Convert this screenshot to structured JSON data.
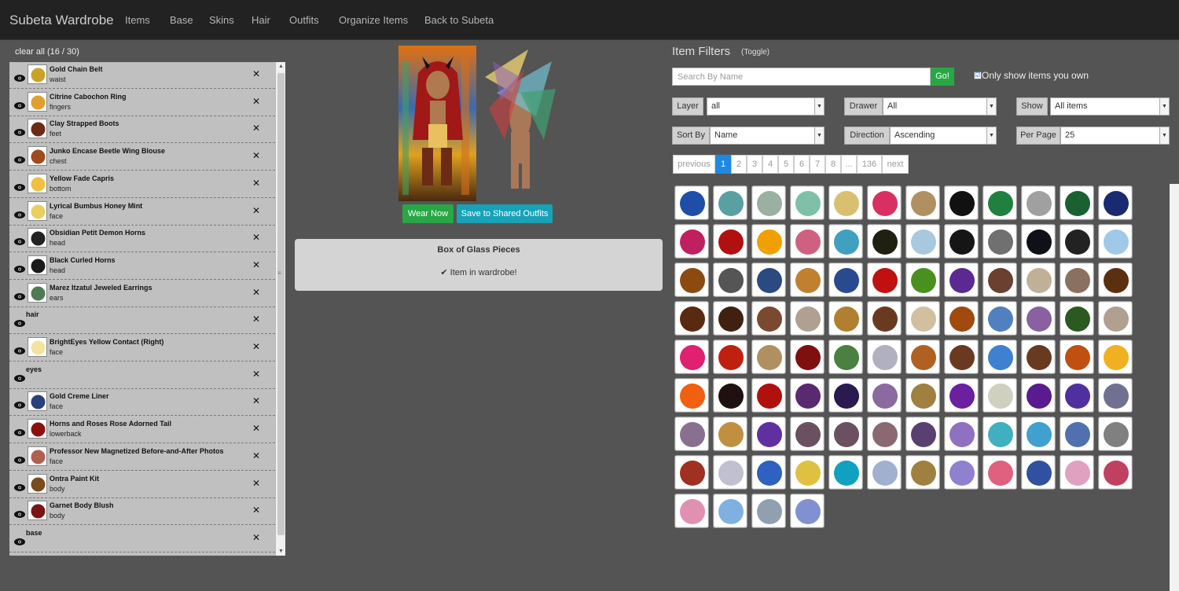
{
  "navbar": {
    "brand": "Subeta Wardrobe",
    "links": [
      "Items",
      "Base",
      "Skins",
      "Hair",
      "Outfits",
      "Organize Items",
      "Back to Subeta"
    ]
  },
  "layers": {
    "clear_all": "clear all (16 / 30)",
    "rows": [
      {
        "name": "Gold Chain Belt",
        "slot": "waist",
        "color": "#c9a227"
      },
      {
        "name": "Citrine Cabochon Ring",
        "slot": "fingers",
        "color": "#e0a030"
      },
      {
        "name": "Clay Strapped Boots",
        "slot": "feet",
        "color": "#6b2b14"
      },
      {
        "name": "Junko Encase Beetle Wing Blouse",
        "slot": "chest",
        "color": "#a04a20"
      },
      {
        "name": "Yellow Fade Capris",
        "slot": "bottom",
        "color": "#f0c040"
      },
      {
        "name": "Lyrical Bumbus Honey Mint",
        "slot": "face",
        "color": "#e8d060"
      },
      {
        "name": "Obsidian Petit Demon Horns",
        "slot": "head",
        "color": "#222222"
      },
      {
        "name": "Black Curled Horns",
        "slot": "head",
        "color": "#1a1a1a"
      },
      {
        "name": "Marez Itzatul Jeweled Earrings",
        "slot": "ears",
        "color": "#4f7a54"
      },
      {
        "name": "hair",
        "slot": "",
        "color": ""
      },
      {
        "name": "BrightEyes Yellow Contact (Right)",
        "slot": "face",
        "color": "#f4e2a0"
      },
      {
        "name": "eyes",
        "slot": "",
        "color": ""
      },
      {
        "name": "Gold Creme Liner",
        "slot": "face",
        "color": "#2b3f7a"
      },
      {
        "name": "Horns and Roses Rose Adorned Tail",
        "slot": "lowerback",
        "color": "#8a1010"
      },
      {
        "name": "Professor New Magnetized Before-and-After Photos",
        "slot": "face",
        "color": "#b06050"
      },
      {
        "name": "Ontra Paint Kit",
        "slot": "body",
        "color": "#7a4a20"
      },
      {
        "name": "Garnet Body Blush",
        "slot": "body",
        "color": "#7a1515"
      },
      {
        "name": "base",
        "slot": "",
        "color": ""
      }
    ]
  },
  "preview": {
    "wear_now": "Wear Now",
    "save_shared": "Save to Shared Outfits",
    "item_title": "Box of Glass Pieces",
    "item_status": "✔ Item in wardrobe!"
  },
  "filters": {
    "title": "Item Filters",
    "toggle": "(Toggle)",
    "search_placeholder": "Search By Name",
    "go": "Go!",
    "own_checkbox": "☑",
    "own_label": "Only show items you own",
    "fields": [
      {
        "label": "Layer",
        "value": "all"
      },
      {
        "label": "Drawer",
        "value": "All"
      },
      {
        "label": "Show",
        "value": "All items"
      },
      {
        "label": "Sort By",
        "value": "Name"
      },
      {
        "label": "Direction",
        "value": "Ascending"
      },
      {
        "label": "Per Page",
        "value": "25"
      }
    ]
  },
  "pagination": [
    "previous",
    "1",
    "2",
    "3",
    "4",
    "5",
    "6",
    "7",
    "8",
    "...",
    "136",
    "next"
  ],
  "items": [
    {
      "icon": "blue-balloon-icon",
      "color": "#1f4ea8"
    },
    {
      "icon": "goggles-icon",
      "color": "#5aa0a0"
    },
    {
      "icon": "sword-icon",
      "color": "#9ab0a0"
    },
    {
      "icon": "winged-hat-icon",
      "color": "#7fc0a8"
    },
    {
      "icon": "wreath-icon",
      "color": "#d8c070"
    },
    {
      "icon": "2009-sign-icon",
      "color": "#d83060"
    },
    {
      "icon": "beads-icon",
      "color": "#b09060"
    },
    {
      "icon": "2013-sign-icon",
      "color": "#111111"
    },
    {
      "icon": "party-hat-icon",
      "color": "#208040"
    },
    {
      "icon": "silver-hat-icon",
      "color": "#a0a0a0"
    },
    {
      "icon": "2013-green-sign-icon",
      "color": "#1a6030"
    },
    {
      "icon": "2013-blue-sign-icon",
      "color": "#1a2a70"
    },
    {
      "icon": "2013-pink-sign-icon",
      "color": "#c02060"
    },
    {
      "icon": "2013-red-sign-icon",
      "color": "#b01010"
    },
    {
      "icon": "orange-balloon-icon",
      "color": "#f0a000"
    },
    {
      "icon": "2014-sign-icon",
      "color": "#d06080"
    },
    {
      "icon": "2014-swirl-icon",
      "color": "#40a0c0"
    },
    {
      "icon": "black-book-icon",
      "color": "#202010"
    },
    {
      "icon": "ice-block-icon",
      "color": "#a8c8e0"
    },
    {
      "icon": "black-bag-icon",
      "color": "#151515"
    },
    {
      "icon": "grey-shorts-icon",
      "color": "#707070"
    },
    {
      "icon": "black-hood-icon",
      "color": "#101018"
    },
    {
      "icon": "accordion-icon",
      "color": "#222222"
    },
    {
      "icon": "ice-cube-icon",
      "color": "#a0c8e8"
    },
    {
      "icon": "acorn-icon",
      "color": "#8a4a10"
    },
    {
      "icon": "spider-icon",
      "color": "#555555"
    },
    {
      "icon": "jeans-icon",
      "color": "#2a4a80"
    },
    {
      "icon": "lipstick-icon",
      "color": "#c08030"
    },
    {
      "icon": "swimsuit-icon",
      "color": "#2a4a90"
    },
    {
      "icon": "ladybug-icon",
      "color": "#c01010"
    },
    {
      "icon": "leaf-wreath-icon",
      "color": "#4a9020"
    },
    {
      "icon": "purple-dragon-icon",
      "color": "#5a2a90"
    },
    {
      "icon": "gargoyle-icon",
      "color": "#6a4030"
    },
    {
      "icon": "mask-icon",
      "color": "#c0b098"
    },
    {
      "icon": "rope-icon",
      "color": "#8a7060"
    },
    {
      "icon": "brown-pants-icon",
      "color": "#5a3010"
    },
    {
      "icon": "brown-pistol-icon",
      "color": "#5a2a10"
    },
    {
      "icon": "whip-icon",
      "color": "#402010"
    },
    {
      "icon": "fur-coat-icon",
      "color": "#7a4a30"
    },
    {
      "icon": "bust-icon",
      "color": "#b0a090"
    },
    {
      "icon": "cookie-icon",
      "color": "#b08030"
    },
    {
      "icon": "brown-ring-icon",
      "color": "#6a3a20"
    },
    {
      "icon": "rock-icon",
      "color": "#d0c0a0"
    },
    {
      "icon": "brown-scarf-icon",
      "color": "#a04a10"
    },
    {
      "icon": "blue-swirl-icon",
      "color": "#5080c0"
    },
    {
      "icon": "purple-face-icon",
      "color": "#8a60a0"
    },
    {
      "icon": "green-bush-icon",
      "color": "#2a5a20"
    },
    {
      "icon": "doll-icon",
      "color": "#b0a090"
    },
    {
      "icon": "pink-cap-icon",
      "color": "#e02070"
    },
    {
      "icon": "red-card-icon",
      "color": "#c02010"
    },
    {
      "icon": "tan-hat-icon",
      "color": "#b09060"
    },
    {
      "icon": "red-lips-icon",
      "color": "#801010"
    },
    {
      "icon": "green-plate-icon",
      "color": "#4a8040"
    },
    {
      "icon": "skirt-icon",
      "color": "#b0b0c0"
    },
    {
      "icon": "mushroom-icon",
      "color": "#b06020"
    },
    {
      "icon": "frame-icon",
      "color": "#6a3a20"
    },
    {
      "icon": "blue-glass-icon",
      "color": "#4080d0"
    },
    {
      "icon": "brown-hair-icon",
      "color": "#6a3a20"
    },
    {
      "icon": "orange-beads-icon",
      "color": "#c05010"
    },
    {
      "icon": "yellow-orb-icon",
      "color": "#f0b020"
    },
    {
      "icon": "fire-orb-icon",
      "color": "#f06010"
    },
    {
      "icon": "staff-icon",
      "color": "#201010"
    },
    {
      "icon": "notebook-icon",
      "color": "#b01010"
    },
    {
      "icon": "purple-box-icon",
      "color": "#5a2a70"
    },
    {
      "icon": "butterfly-icon",
      "color": "#2a1a50"
    },
    {
      "icon": "amulet-icon",
      "color": "#8a6aa0"
    },
    {
      "icon": "gold-chain-icon",
      "color": "#a08040"
    },
    {
      "icon": "purple-hoops-icon",
      "color": "#6a20a0"
    },
    {
      "icon": "white-cloth-icon",
      "color": "#d0d0c0"
    },
    {
      "icon": "purple-flower-icon",
      "color": "#5a1a90"
    },
    {
      "icon": "purple-shoe-icon",
      "color": "#5030a0"
    },
    {
      "icon": "purple-gem-icon",
      "color": "#707090"
    },
    {
      "icon": "purple-top-icon",
      "color": "#8a7090"
    },
    {
      "icon": "hook-icon",
      "color": "#c09040"
    },
    {
      "icon": "scissors-icon",
      "color": "#6030a0"
    },
    {
      "icon": "boots-icon",
      "color": "#6a5060"
    },
    {
      "icon": "armor-icon",
      "color": "#6a5060"
    },
    {
      "icon": "vest-icon",
      "color": "#8a6a70"
    },
    {
      "icon": "bracelet-icon",
      "color": "#5a4070"
    },
    {
      "icon": "earring-icon",
      "color": "#9070c0"
    },
    {
      "icon": "ice-star-icon",
      "color": "#40b0c0"
    },
    {
      "icon": "ice-shard-icon",
      "color": "#40a0d0"
    },
    {
      "icon": "striped-pants-icon",
      "color": "#5070b0"
    },
    {
      "icon": "grey-rocks-icon",
      "color": "#808080"
    },
    {
      "icon": "red-sleeve-icon",
      "color": "#a03020"
    },
    {
      "icon": "white-wings-icon",
      "color": "#c0c0d0"
    },
    {
      "icon": "blue-cap-icon",
      "color": "#3060c0"
    },
    {
      "icon": "yellow-ribbon-icon",
      "color": "#e0c040"
    },
    {
      "icon": "cyan-stockings-icon",
      "color": "#10a0c0"
    },
    {
      "icon": "bear-icon",
      "color": "#a0b0d0"
    },
    {
      "icon": "gold-wings-icon",
      "color": "#a08040"
    },
    {
      "icon": "purple-slippers-icon",
      "color": "#9080d0"
    },
    {
      "icon": "pink-collar-icon",
      "color": "#e06080"
    },
    {
      "icon": "blue-stockings-icon",
      "color": "#3050a0"
    },
    {
      "icon": "cat-ears-icon",
      "color": "#e0a0c0"
    },
    {
      "icon": "pink-creature-icon",
      "color": "#c04060"
    },
    {
      "icon": "pink-wings-icon",
      "color": "#e090b0"
    },
    {
      "icon": "crystal-ball-icon",
      "color": "#80b0e0"
    },
    {
      "icon": "skull-icon",
      "color": "#90a0b0"
    },
    {
      "icon": "fairy-hat-icon",
      "color": "#8090d0"
    }
  ]
}
